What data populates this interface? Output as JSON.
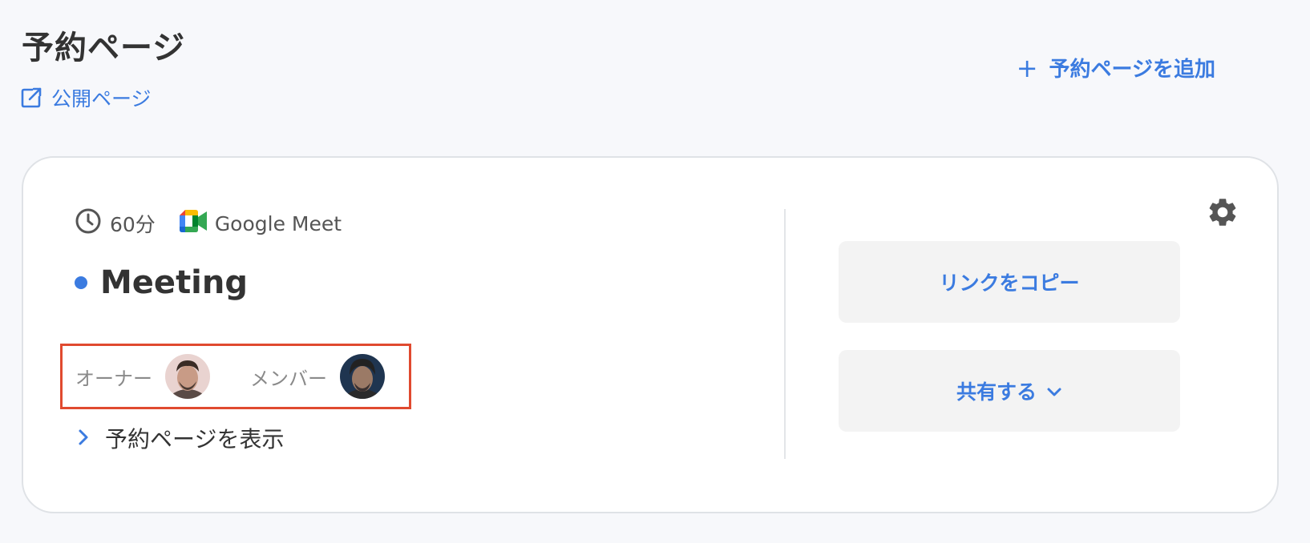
{
  "header": {
    "title": "予約ページ",
    "public_link_label": "公開ページ",
    "add_button_label": "予約ページを追加"
  },
  "card": {
    "duration": "60分",
    "meeting_tool": "Google Meet",
    "title": "Meeting",
    "owner_label": "オーナー",
    "member_label": "メンバー",
    "view_link_label": "予約ページを表示",
    "copy_button_label": "リンクをコピー",
    "share_button_label": "共有する"
  },
  "colors": {
    "accent": "#3b7be0",
    "highlight_border": "#e04a2f",
    "background": "#f7f8fb",
    "card": "#ffffff",
    "button_bg": "#f3f3f3"
  },
  "icons": {
    "public_link": "external-link-icon",
    "add": "plus-icon",
    "duration": "clock-icon",
    "meeting_tool": "google-meet-icon",
    "view_link": "chevron-right-icon",
    "share": "chevron-down-icon",
    "settings": "gear-icon"
  }
}
